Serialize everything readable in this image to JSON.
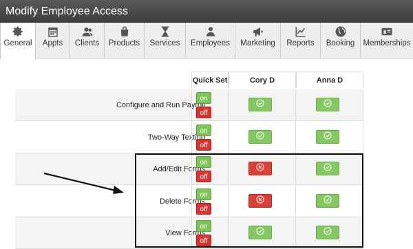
{
  "window": {
    "title": "Modify Employee Access"
  },
  "tabs": [
    {
      "label": "General",
      "icon": "gear-icon",
      "active": true
    },
    {
      "label": "Appts",
      "icon": "calendar-icon",
      "active": false
    },
    {
      "label": "Clients",
      "icon": "clients-icon",
      "active": false
    },
    {
      "label": "Products",
      "icon": "shopping-bag-icon",
      "active": false
    },
    {
      "label": "Services",
      "icon": "hourglass-icon",
      "active": false
    },
    {
      "label": "Employees",
      "icon": "employee-icon",
      "active": false
    },
    {
      "label": "Marketing",
      "icon": "megaphone-icon",
      "active": false
    },
    {
      "label": "Reports",
      "icon": "line-chart-icon",
      "active": false
    },
    {
      "label": "Booking",
      "icon": "globe-icon",
      "active": false
    },
    {
      "label": "Memberships",
      "icon": "id-card-icon",
      "active": false
    }
  ],
  "table": {
    "headers": {
      "quick_set": "Quick Set",
      "employees": [
        "Cory D",
        "Anna D"
      ]
    },
    "on_label": "on",
    "off_label": "off",
    "rows": [
      {
        "label": "Configure and Run Payroll",
        "cory": "allowed",
        "anna": "allowed"
      },
      {
        "label": "Two-Way Texting",
        "cory": "allowed",
        "anna": "allowed"
      },
      {
        "label": "Add/Edit Forms",
        "cory": "denied",
        "anna": "allowed"
      },
      {
        "label": "Delete Forms",
        "cory": "denied",
        "anna": "allowed"
      },
      {
        "label": "View Forms",
        "cory": "allowed",
        "anna": "allowed"
      }
    ]
  },
  "colors": {
    "allowed": "#86c765",
    "denied": "#d8403a",
    "on": "#7fc35a",
    "off": "#d9342f",
    "annotation": "#111111"
  }
}
